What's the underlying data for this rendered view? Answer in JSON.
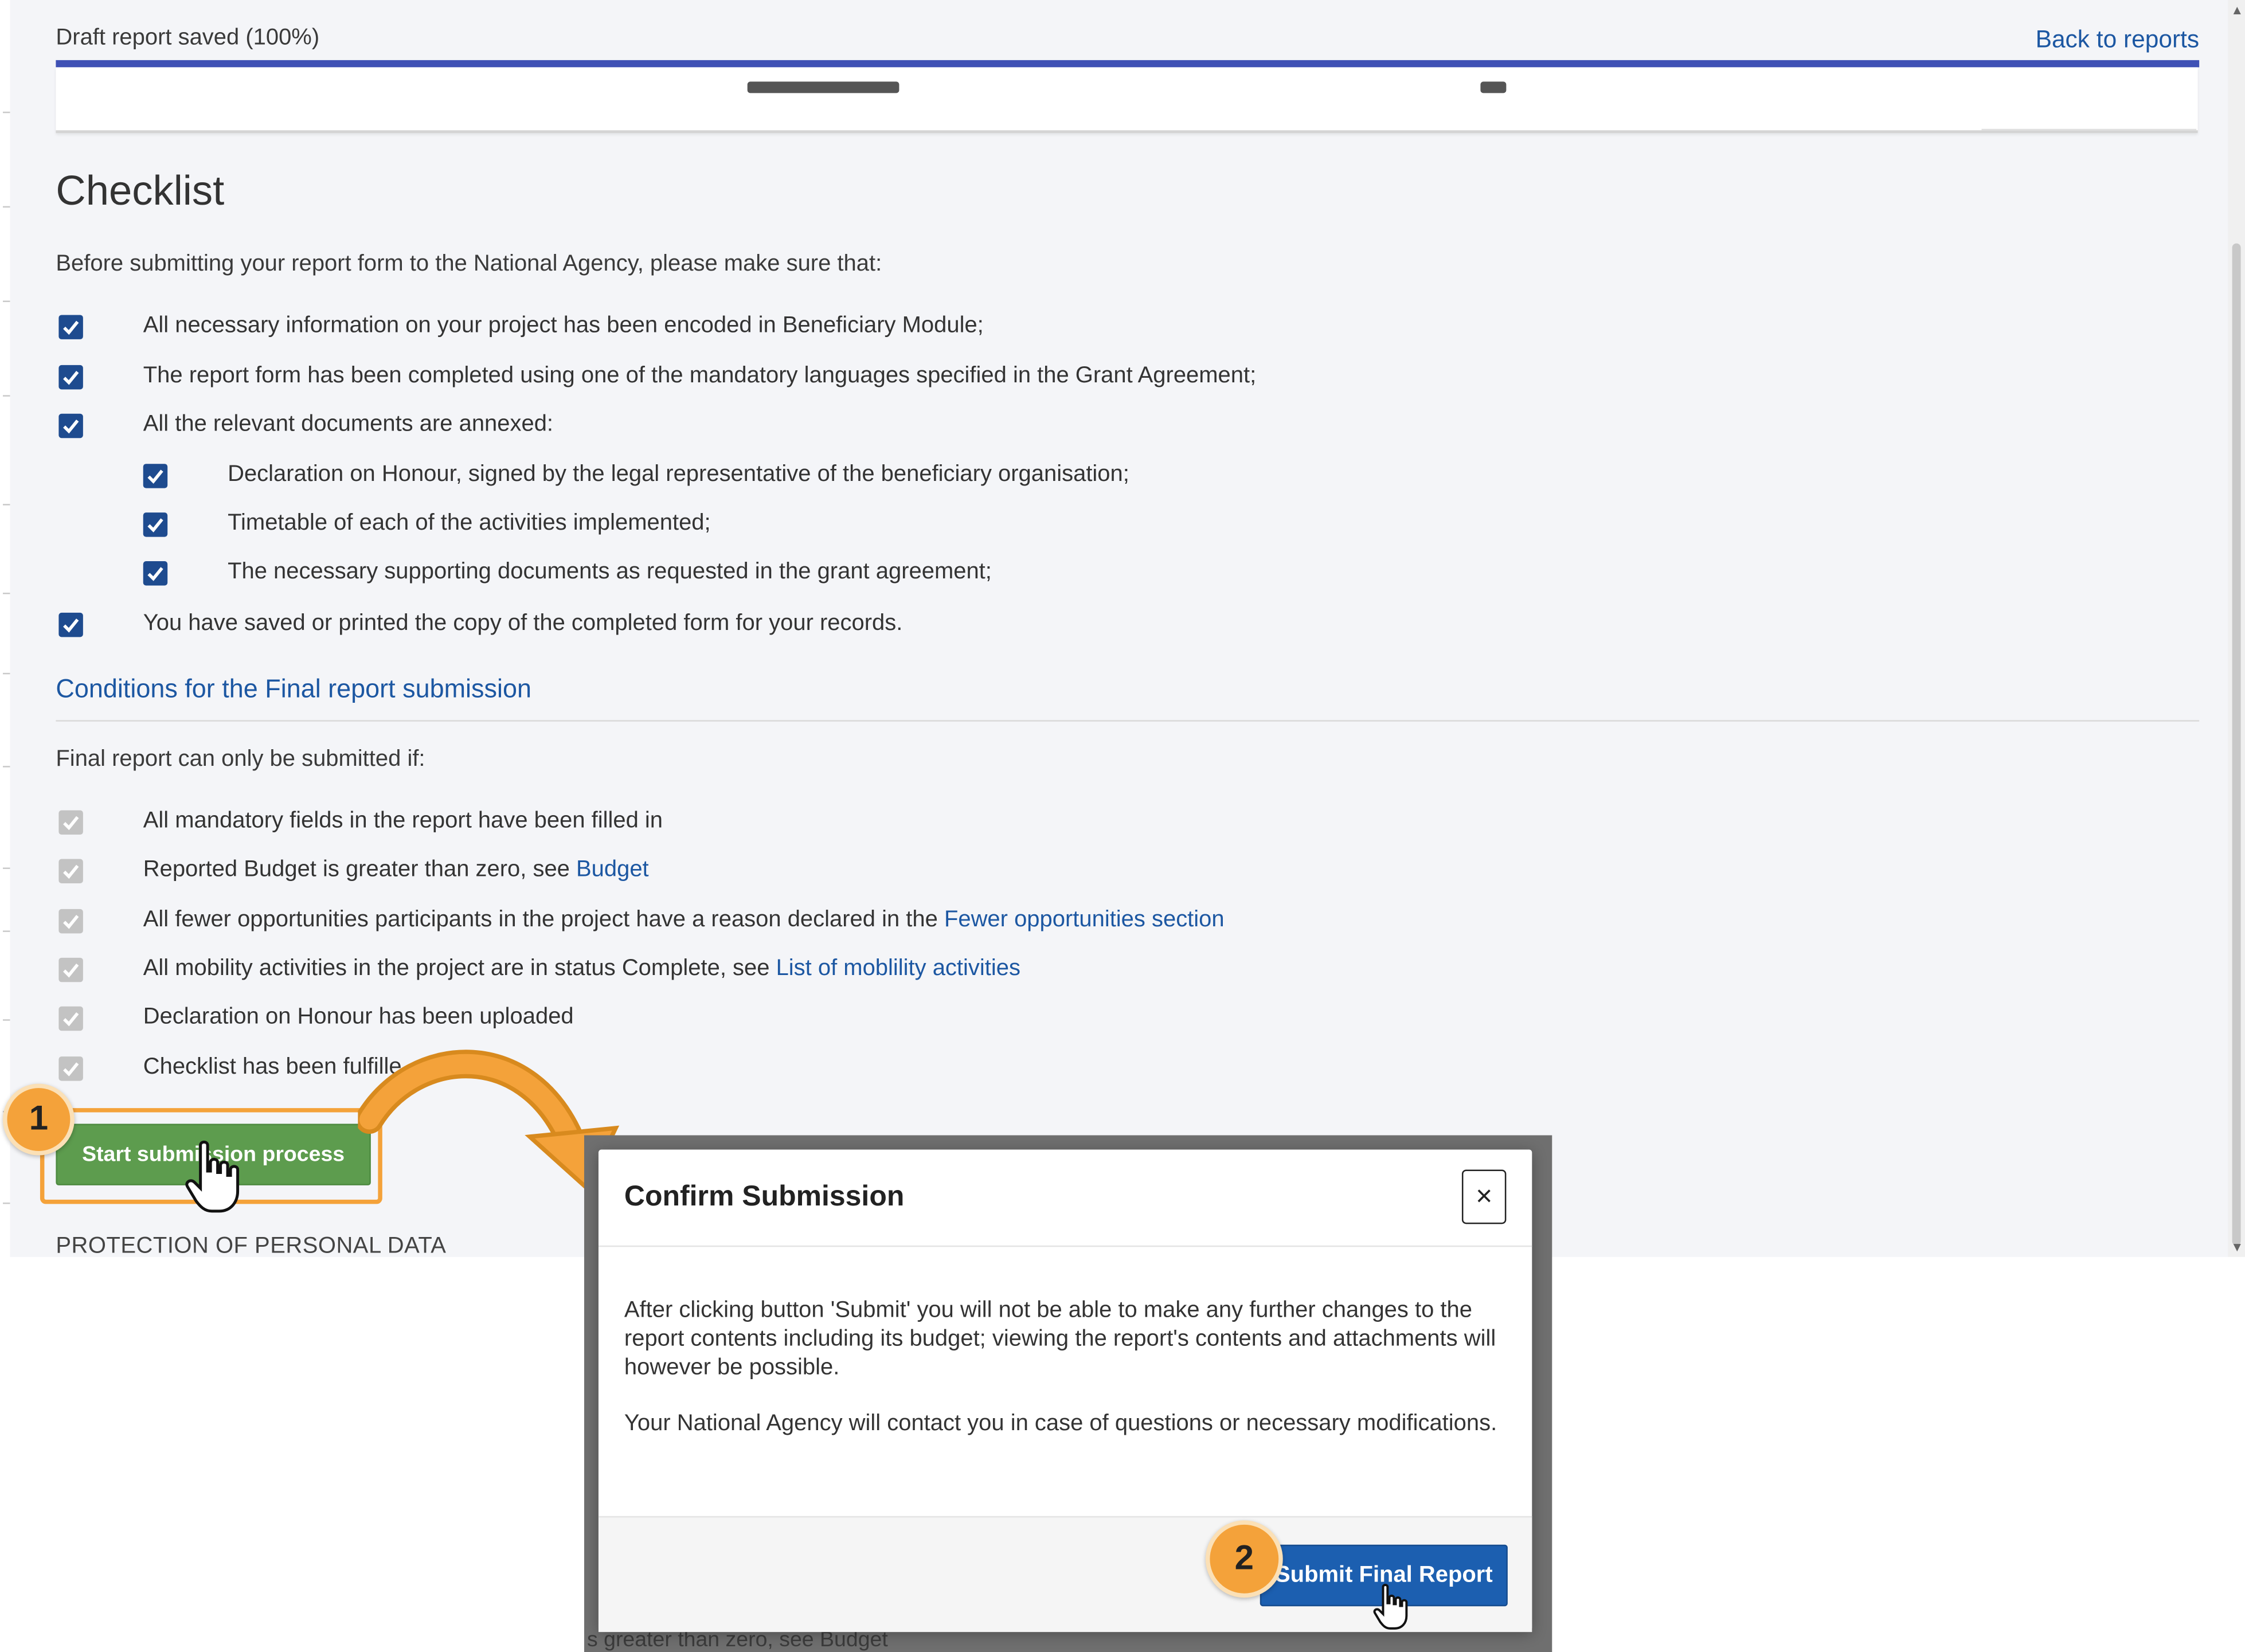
{
  "header": {
    "status": "Draft report saved (100%)",
    "back_link": "Back to reports"
  },
  "checklist": {
    "title": "Checklist",
    "intro": "Before submitting your report form to the National Agency, please make sure that:",
    "items": [
      "All necessary information on your project has been encoded in Beneficiary Module;",
      "The report form has been completed using one of the mandatory languages specified in the Grant Agreement;",
      "All the relevant documents are annexed:",
      "Declaration on Honour, signed by the legal representative of the beneficiary organisation;",
      "Timetable of each of the activities implemented;",
      "The necessary supporting documents as requested in the grant agreement;",
      "You have saved or printed the copy of the completed form for your records."
    ]
  },
  "conditions": {
    "title": "Conditions for the Final report submission",
    "intro": "Final report can only be submitted if:",
    "items": [
      {
        "text": "All mandatory fields in the report have been filled in",
        "link": ""
      },
      {
        "text": "Reported Budget is greater than zero, see ",
        "link": "Budget"
      },
      {
        "text": "All fewer opportunities participants in the project have a reason declared in the ",
        "link": "Fewer opportunities section"
      },
      {
        "text": "All mobility activities in the project are in status Complete, see ",
        "link": "List of moblility activities"
      },
      {
        "text": "Declaration on Honour has been uploaded",
        "link": ""
      },
      {
        "text": "Checklist has been fulfille",
        "link": ""
      }
    ]
  },
  "start_button": "Start submission process",
  "protection_heading": "PROTECTION OF PERSONAL DATA",
  "callouts": {
    "step1": "1",
    "step2": "2"
  },
  "modal": {
    "title": "Confirm Submission",
    "close_symbol": "×",
    "paragraph1": "After clicking button 'Submit' you will not be able to make any further changes to the report contents including its budget; viewing the report's contents and attachments will however be possible.",
    "paragraph2": "Your National Agency will contact you in case of questions or necessary modifications.",
    "submit_button": "Submit Final Report"
  },
  "background_fragments": {
    "line_bottom": "s greater than zero, see ",
    "line_bottom_link": "Budget"
  },
  "colors": {
    "accent": "#3f51b5",
    "link": "#1c57a2",
    "checkbox": "#1e4b8f",
    "start_button": "#5d9c4e",
    "submit_button": "#1c5fb0",
    "callout": "#f4a23a"
  },
  "icons": {
    "checked": "checkmark-icon",
    "close": "close-icon",
    "pointer": "hand-pointer-icon",
    "arrow": "curved-arrow-icon"
  }
}
